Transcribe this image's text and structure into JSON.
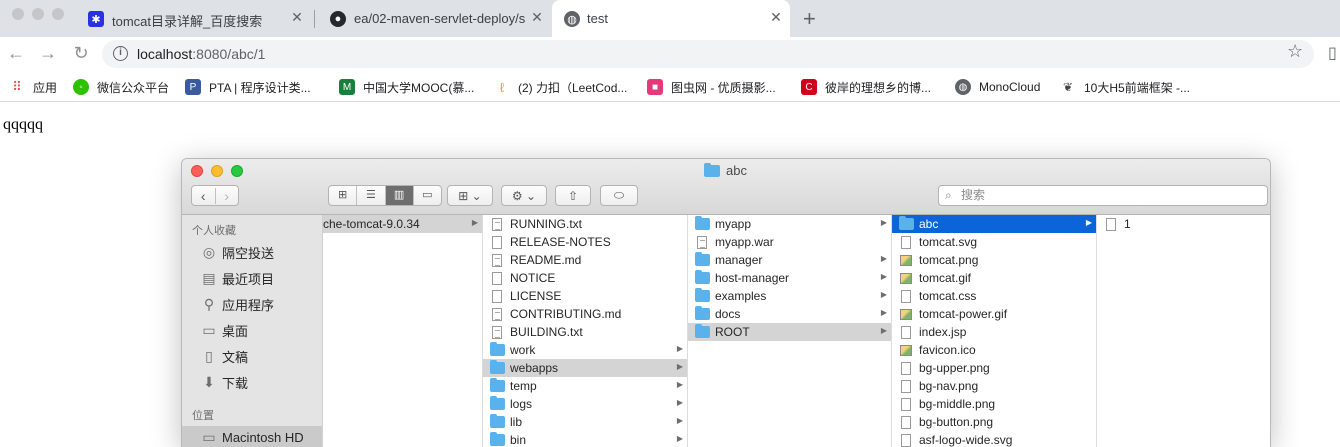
{
  "browser": {
    "tabs": [
      {
        "title": "tomcat目录详解_百度搜索",
        "icon": "baidu-icon"
      },
      {
        "title": "ea/02-maven-servlet-deploy/s",
        "icon": "github-icon"
      },
      {
        "title": "test",
        "icon": "globe-icon"
      }
    ],
    "url_host": "localhost",
    "url_rest": ":8080/abc/1",
    "info_glyph": "i",
    "new_tab_glyph": "+",
    "close_glyph": "✕"
  },
  "bookmarks": [
    {
      "label": "应用",
      "icon": "apps-icon"
    },
    {
      "label": "微信公众平台",
      "icon": "wechat-icon"
    },
    {
      "label": "PTA | 程序设计类...",
      "icon": "pta-icon"
    },
    {
      "label": "中国大学MOOC(慕...",
      "icon": "mooc-icon"
    },
    {
      "label": "(2) 力扣（LeetCod...",
      "icon": "leetcode-icon"
    },
    {
      "label": "图虫网 - 优质摄影...",
      "icon": "tuchong-icon"
    },
    {
      "label": "彼岸的理想乡的博...",
      "icon": "csdn-icon"
    },
    {
      "label": "MonoCloud",
      "icon": "monocloud-icon"
    },
    {
      "label": "10大H5前端框架 -...",
      "icon": "h5-icon"
    }
  ],
  "page": {
    "body_text": "qqqqq"
  },
  "finder": {
    "title": "abc",
    "search_placeholder": "搜索",
    "sidebar": {
      "favorites_header": "个人收藏",
      "favorites": [
        {
          "label": "隔空投送",
          "icon": "airdrop-icon"
        },
        {
          "label": "最近项目",
          "icon": "recents-icon"
        },
        {
          "label": "应用程序",
          "icon": "applications-icon"
        },
        {
          "label": "桌面",
          "icon": "desktop-icon"
        },
        {
          "label": "文稿",
          "icon": "documents-icon"
        },
        {
          "label": "下载",
          "icon": "downloads-icon"
        }
      ],
      "locations_header": "位置",
      "locations": [
        {
          "label": "Macintosh HD",
          "icon": "disk-icon"
        }
      ]
    },
    "columns": [
      {
        "items": [
          {
            "name": "che-tomcat-9.0.34",
            "type": "plain",
            "arrow": true,
            "state": "grey"
          }
        ]
      },
      {
        "items": [
          {
            "name": "RUNNING.txt",
            "type": "doc-lined"
          },
          {
            "name": "RELEASE-NOTES",
            "type": "doc"
          },
          {
            "name": "README.md",
            "type": "doc-lined"
          },
          {
            "name": "NOTICE",
            "type": "doc"
          },
          {
            "name": "LICENSE",
            "type": "doc"
          },
          {
            "name": "CONTRIBUTING.md",
            "type": "doc-lined"
          },
          {
            "name": "BUILDING.txt",
            "type": "doc-lined"
          },
          {
            "name": "work",
            "type": "folder",
            "arrow": true
          },
          {
            "name": "webapps",
            "type": "folder",
            "arrow": true,
            "state": "grey"
          },
          {
            "name": "temp",
            "type": "folder",
            "arrow": true
          },
          {
            "name": "logs",
            "type": "folder",
            "arrow": true
          },
          {
            "name": "lib",
            "type": "folder",
            "arrow": true
          },
          {
            "name": "bin",
            "type": "folder",
            "arrow": true
          }
        ]
      },
      {
        "items": [
          {
            "name": "myapp",
            "type": "folder",
            "arrow": true
          },
          {
            "name": "myapp.war",
            "type": "doc-lined"
          },
          {
            "name": "manager",
            "type": "folder",
            "arrow": true
          },
          {
            "name": "host-manager",
            "type": "folder",
            "arrow": true
          },
          {
            "name": "examples",
            "type": "folder",
            "arrow": true
          },
          {
            "name": "docs",
            "type": "folder",
            "arrow": true
          },
          {
            "name": "ROOT",
            "type": "folder",
            "arrow": true,
            "state": "grey"
          }
        ]
      },
      {
        "items": [
          {
            "name": "abc",
            "type": "folder",
            "arrow": true,
            "state": "blue"
          },
          {
            "name": "tomcat.svg",
            "type": "doc"
          },
          {
            "name": "tomcat.png",
            "type": "img"
          },
          {
            "name": "tomcat.gif",
            "type": "img"
          },
          {
            "name": "tomcat.css",
            "type": "doc"
          },
          {
            "name": "tomcat-power.gif",
            "type": "img"
          },
          {
            "name": "index.jsp",
            "type": "doc"
          },
          {
            "name": "favicon.ico",
            "type": "img"
          },
          {
            "name": "bg-upper.png",
            "type": "doc"
          },
          {
            "name": "bg-nav.png",
            "type": "doc"
          },
          {
            "name": "bg-middle.png",
            "type": "doc"
          },
          {
            "name": "bg-button.png",
            "type": "doc"
          },
          {
            "name": "asf-logo-wide.svg",
            "type": "doc"
          }
        ]
      },
      {
        "items": [
          {
            "name": "1",
            "type": "doc"
          }
        ]
      }
    ]
  },
  "colors": {
    "selection_blue": "#0b64d8",
    "folder_blue": "#5ab2ec",
    "close_red": "#fe5f57",
    "minimize_yellow": "#febc2e",
    "zoom_green": "#28c840"
  }
}
